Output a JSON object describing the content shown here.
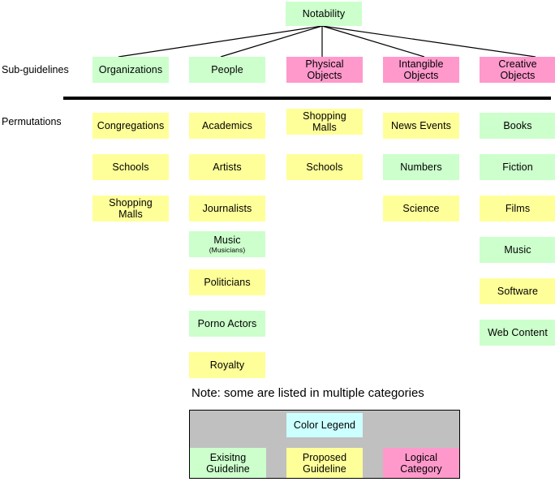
{
  "title": "Notability",
  "rows": {
    "subguidelines_label": "Sub-guidelines",
    "permutations_label": "Permutations"
  },
  "root": {
    "label": "Notability",
    "color": "#ccffcc"
  },
  "subguidelines": [
    {
      "label": "Organizations",
      "color": "#ccffcc"
    },
    {
      "label": "People",
      "color": "#ccffcc"
    },
    {
      "label": "Physical Objects",
      "line1": "Physical",
      "line2": "Objects",
      "color": "#ff99cc"
    },
    {
      "label": "Intangible Objects",
      "line1": "Intangible",
      "line2": "Objects",
      "color": "#ff99cc"
    },
    {
      "label": "Creative Objects",
      "line1": "Creative",
      "line2": "Objects",
      "color": "#ff99cc"
    }
  ],
  "permutations": {
    "col1": [
      {
        "label": "Congregations",
        "color": "#ffff99"
      },
      {
        "label": "Schools",
        "color": "#ffff99"
      },
      {
        "label": "Shopping Malls",
        "line1": "Shopping",
        "line2": "Malls",
        "color": "#ffff99"
      }
    ],
    "col2": [
      {
        "label": "Academics",
        "color": "#ffff99"
      },
      {
        "label": "Artists",
        "color": "#ffff99"
      },
      {
        "label": "Journalists",
        "color": "#ffff99"
      },
      {
        "label": "Music",
        "sublabel": "(Musicians)",
        "color": "#ccffcc"
      },
      {
        "label": "Politicians",
        "color": "#ffff99"
      },
      {
        "label": "Porno Actors",
        "color": "#ccffcc"
      },
      {
        "label": "Royalty",
        "color": "#ffff99"
      }
    ],
    "col3": [
      {
        "label": "Shopping Malls",
        "line1": "Shopping",
        "line2": "Malls",
        "color": "#ffff99"
      },
      {
        "label": "Schools",
        "color": "#ffff99"
      }
    ],
    "col4": [
      {
        "label": "News Events",
        "color": "#ffff99"
      },
      {
        "label": "Numbers",
        "color": "#ccffcc"
      },
      {
        "label": "Science",
        "color": "#ffff99"
      }
    ],
    "col5": [
      {
        "label": "Books",
        "color": "#ccffcc"
      },
      {
        "label": "Fiction",
        "color": "#ccffcc"
      },
      {
        "label": "Films",
        "color": "#ffff99"
      },
      {
        "label": "Music",
        "color": "#ccffcc"
      },
      {
        "label": "Software",
        "color": "#ffff99"
      },
      {
        "label": "Web Content",
        "color": "#ccffcc"
      }
    ]
  },
  "note": "Note: some are listed in multiple categories",
  "legend": {
    "title": "Color Legend",
    "title_color": "#ccffff",
    "background": "#c0c0c0",
    "items": [
      {
        "line1": "Exisitng",
        "line2": "Guideline",
        "color": "#ccffcc"
      },
      {
        "line1": "Proposed",
        "line2": "Guideline",
        "color": "#ffff99"
      },
      {
        "line1": "Logical",
        "line2": "Category",
        "color": "#ff99cc"
      }
    ]
  }
}
